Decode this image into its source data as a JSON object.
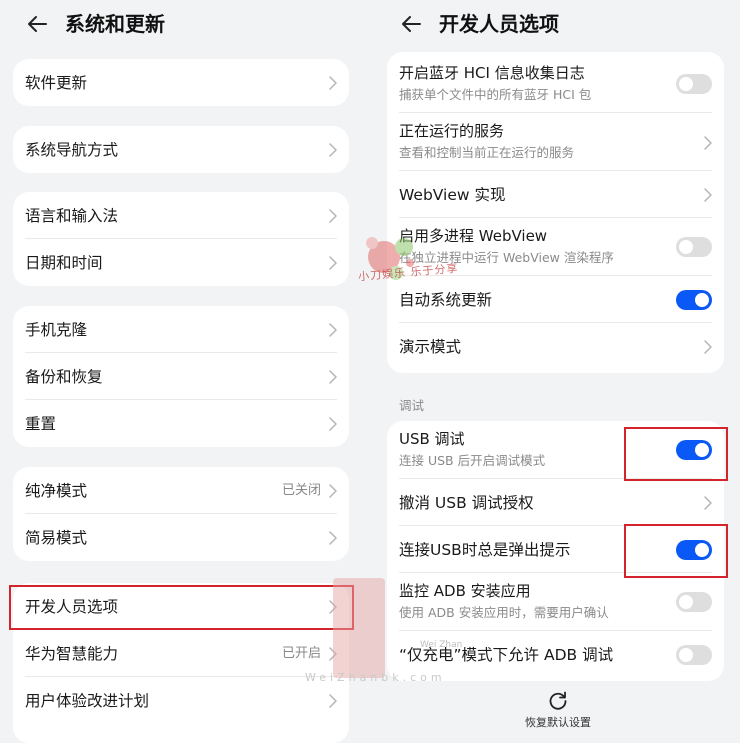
{
  "left": {
    "title": "系统和更新",
    "groups": [
      {
        "items": [
          {
            "label": "软件更新",
            "value": ""
          }
        ]
      },
      {
        "items": [
          {
            "label": "系统导航方式",
            "value": ""
          }
        ]
      },
      {
        "items": [
          {
            "label": "语言和输入法",
            "value": ""
          },
          {
            "label": "日期和时间",
            "value": ""
          }
        ]
      },
      {
        "items": [
          {
            "label": "手机克隆",
            "value": ""
          },
          {
            "label": "备份和恢复",
            "value": ""
          },
          {
            "label": "重置",
            "value": ""
          }
        ]
      },
      {
        "items": [
          {
            "label": "纯净模式",
            "value": "已关闭"
          },
          {
            "label": "简易模式",
            "value": ""
          }
        ]
      },
      {
        "items": [
          {
            "label": "开发人员选项",
            "value": ""
          },
          {
            "label": "华为智慧能力",
            "value": "已开启"
          },
          {
            "label": "用户体验改进计划",
            "value": ""
          }
        ]
      }
    ]
  },
  "right": {
    "title": "开发人员选项",
    "items": [
      {
        "label": "开启蓝牙 HCI 信息收集日志",
        "sub": "捕获单个文件中的所有蓝牙 HCI 包",
        "control": "toggle",
        "on": false
      },
      {
        "label": "正在运行的服务",
        "sub": "查看和控制当前正在运行的服务",
        "control": "chevron"
      },
      {
        "label": "WebView 实现",
        "sub": "",
        "control": "chevron"
      },
      {
        "label": "启用多进程 WebView",
        "sub": "在独立进程中运行 WebView 渲染程序",
        "control": "toggle",
        "on": false
      },
      {
        "label": "自动系统更新",
        "sub": "",
        "control": "toggle",
        "on": true
      },
      {
        "label": "演示模式",
        "sub": "",
        "control": "chevron"
      }
    ],
    "section_label": "调试",
    "debug_items": [
      {
        "label": "USB 调试",
        "sub": "连接 USB 后开启调试模式",
        "control": "toggle",
        "on": true
      },
      {
        "label": "撤消 USB 调试授权",
        "sub": "",
        "control": "chevron"
      },
      {
        "label": "连接USB时总是弹出提示",
        "sub": "",
        "control": "toggle",
        "on": true
      },
      {
        "label": "监控 ADB 安装应用",
        "sub": "使用 ADB 安装应用时，需要用户确认",
        "control": "toggle",
        "on": false
      },
      {
        "label": "“仅充电”模式下允许 ADB 调试",
        "sub": "",
        "control": "toggle",
        "on": false
      }
    ],
    "reset_label": "恢复默认设置"
  },
  "watermark": {
    "text": "小刀娱乐 乐于分享",
    "site": "WeiZhanbk.com",
    "small": "Wei Zhan"
  },
  "colors": {
    "accent": "#0a59f7",
    "highlight": "#d3232b",
    "background": "#f1f3f5"
  },
  "icons": {
    "back": "arrow-left-icon",
    "chevron": "chevron-right-icon",
    "reset": "refresh-icon"
  }
}
